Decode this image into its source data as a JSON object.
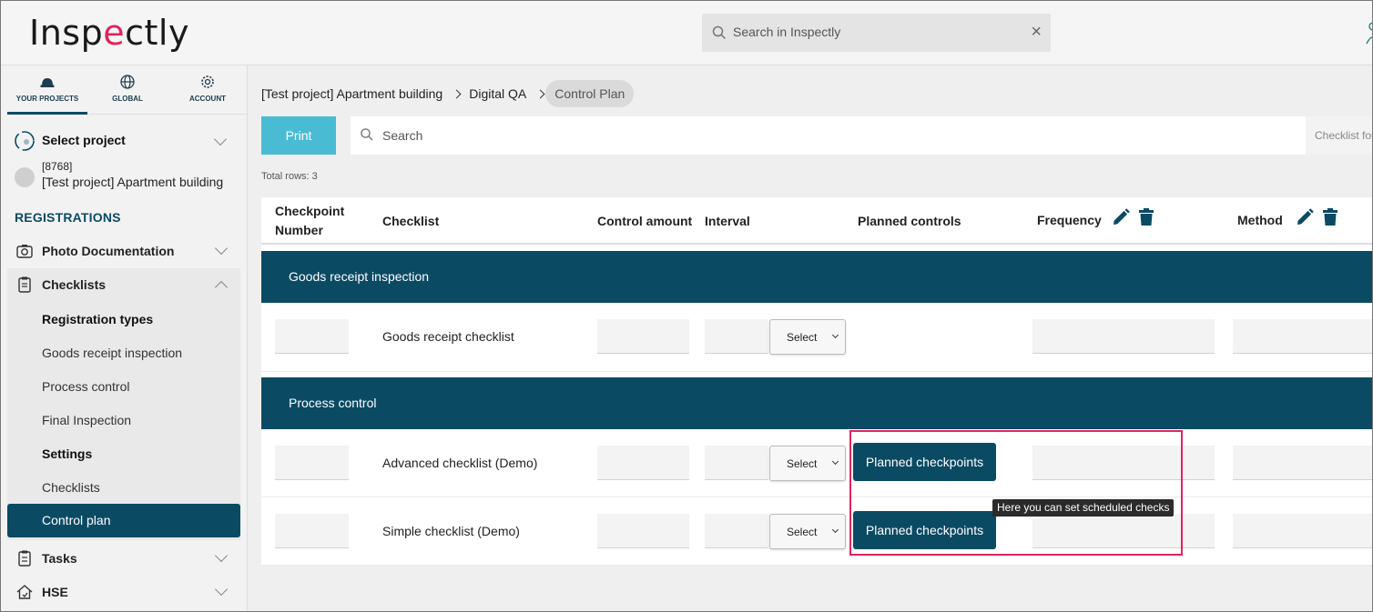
{
  "app": {
    "logo_pre": "Insp",
    "logo_accent": "e",
    "logo_post": "ctly"
  },
  "search": {
    "placeholder": "Search in Inspectly",
    "clear": "×"
  },
  "sidebar": {
    "tabs": [
      {
        "label": "YOUR PROJECTS",
        "icon": "hardhat-icon",
        "active": true
      },
      {
        "label": "GLOBAL",
        "icon": "globe-icon"
      },
      {
        "label": "ACCOUNT",
        "icon": "gear-icon"
      }
    ],
    "select_project": "Select project",
    "project_id": "[8768]",
    "project_name": "[Test project] Apartment building",
    "registrations_heading": "REGISTRATIONS",
    "nav": [
      {
        "label": "Photo Documentation",
        "icon": "camera-icon"
      },
      {
        "label": "Checklists",
        "icon": "clipboard-icon",
        "expanded": true
      },
      {
        "label": "Tasks",
        "icon": "clipboard-list-icon"
      },
      {
        "label": "HSE",
        "icon": "house-icon"
      }
    ],
    "checklist_sub": {
      "registration_types": "Registration types",
      "goods_receipt": "Goods receipt inspection",
      "process_control": "Process control",
      "final_inspection": "Final Inspection",
      "settings": "Settings",
      "checklists": "Checklists",
      "control_plan": "Control plan"
    }
  },
  "breadcrumb": [
    "[Test project] Apartment building",
    "Digital QA",
    "Control Plan"
  ],
  "toolbar": {
    "print": "Print",
    "search_placeholder": "Search",
    "checklist_filter": "Checklist for"
  },
  "total_rows": "Total rows: 3",
  "table": {
    "headers": {
      "checkpoint_number_1": "Checkpoint",
      "checkpoint_number_2": "Number",
      "checklist": "Checklist",
      "control_amount": "Control amount",
      "interval": "Interval",
      "planned_controls": "Planned controls",
      "frequency": "Frequency",
      "method": "Method"
    },
    "groups": [
      {
        "name": "Goods receipt inspection",
        "rows": [
          {
            "checklist": "Goods receipt checklist",
            "select": "Select"
          }
        ]
      },
      {
        "name": "Process control",
        "rows": [
          {
            "checklist": "Advanced checklist (Demo)",
            "select": "Select",
            "planned": "Planned checkpoints"
          },
          {
            "checklist": "Simple checklist (Demo)",
            "select": "Select",
            "planned": "Planned checkpoints"
          }
        ]
      }
    ]
  },
  "tooltip": "Here you can set scheduled checks",
  "colors": {
    "primary": "#0b4a63",
    "print": "#49bcd4",
    "highlight": "#e0245e"
  }
}
